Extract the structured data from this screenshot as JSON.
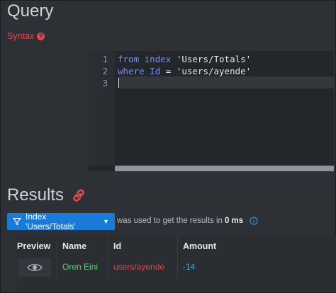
{
  "query": {
    "title": "Query",
    "syntax_label": "Syntax",
    "syntax_help_icon": "question-circle-icon"
  },
  "editor": {
    "line_numbers": [
      "1",
      "2",
      "3"
    ],
    "lines": [
      {
        "kw1": "from",
        "kw2": "index",
        "str": "'Users/Totals'"
      },
      {
        "kw1": "where",
        "field": "Id",
        "op": "=",
        "str": "'users/ayende'"
      },
      {}
    ]
  },
  "results": {
    "title": "Results",
    "link_icon": "link-icon",
    "index_button_label": "Index 'Users/Totals'",
    "filter_icon": "filter-icon",
    "used_text_prefix": "was used to get the results in",
    "duration": "0 ms",
    "info_icon": "info-circle-icon"
  },
  "table": {
    "columns": [
      "Preview",
      "Name",
      "Id",
      "Amount"
    ],
    "rows": [
      {
        "preview_icon": "eye-icon",
        "name": "Oren Eini",
        "id": "users/ayende",
        "amount": "-14"
      }
    ]
  },
  "colors": {
    "background": "#2d3035",
    "accent": "#1a7ad8",
    "error_red": "#e04a52",
    "name_green": "#5fd36a",
    "id_red": "#e2464b",
    "amount_cyan": "#3ab4d8",
    "keyword": "#7b8cf4"
  }
}
